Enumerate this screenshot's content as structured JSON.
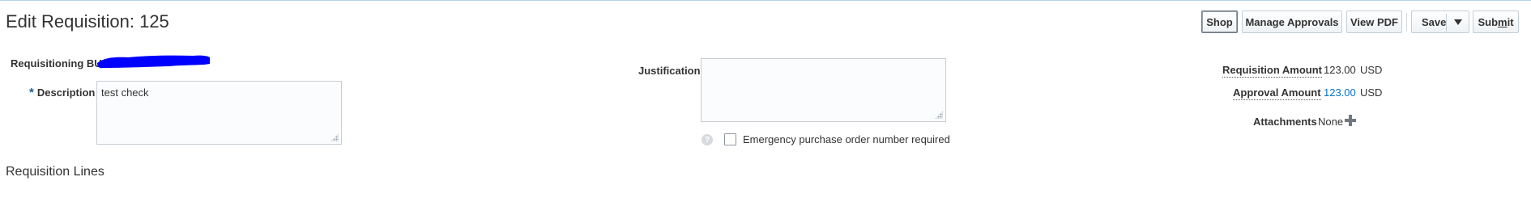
{
  "header": {
    "title": "Edit Requisition: 125"
  },
  "toolbar": {
    "shop": "Shop",
    "manage_approvals": "Manage Approvals",
    "view_pdf": "View PDF",
    "save": "Save",
    "submit_pre": "Sub",
    "submit_mnemonic": "m",
    "submit_post": "it"
  },
  "form": {
    "requisitioning_bu_label": "Requisitioning BU",
    "description_label": "Description",
    "description_required_marker": "*",
    "description_value": "test check",
    "justification_label": "Justification",
    "justification_value": "",
    "emergency_label": "Emergency purchase order number required",
    "emergency_checked": false,
    "help_glyph": "?"
  },
  "summary": {
    "requisition_amount_label": "Requisition Amount",
    "requisition_amount_value": "123.00",
    "requisition_amount_currency": "USD",
    "approval_amount_label": "Approval Amount",
    "approval_amount_value": "123.00",
    "approval_amount_currency": "USD",
    "attachments_label": "Attachments",
    "attachments_value": "None"
  },
  "sections": {
    "requisition_lines": "Requisition Lines"
  },
  "colors": {
    "redaction": "#0000ff",
    "link": "#0572ce",
    "required": "#1c5d9b"
  }
}
